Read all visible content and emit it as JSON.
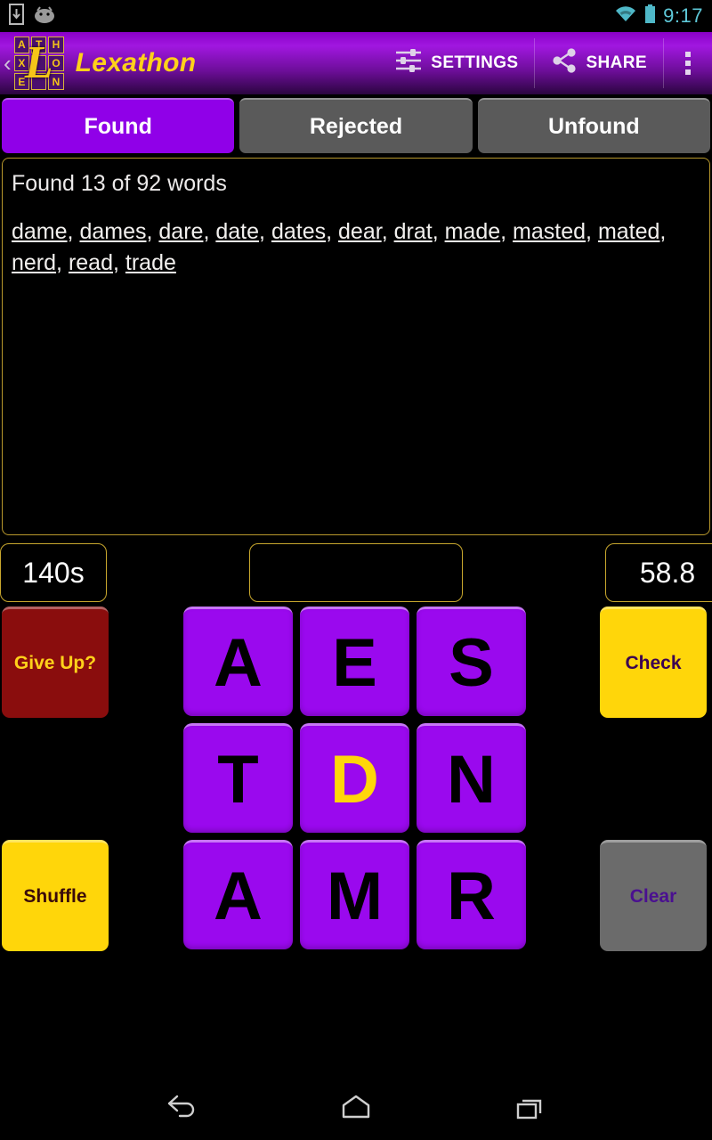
{
  "status_bar": {
    "icons": [
      "download-icon",
      "android-icon"
    ],
    "wifi_icon": "wifi-icon",
    "battery_icon": "battery-icon",
    "time": "9:17",
    "accent_color": "#5ec8d8"
  },
  "action_bar": {
    "up_caret": "‹",
    "logo": {
      "name": "lexathon-logo",
      "letters": [
        "A",
        "T",
        "H",
        "X",
        "",
        "O",
        "E",
        "",
        "N"
      ],
      "overlay_letter": "L",
      "tile_color": "#4a0f6e",
      "letter_color": "#f5c518"
    },
    "title": "Lexathon",
    "title_color": "#ffd11a",
    "settings_label": "SETTINGS",
    "share_label": "SHARE",
    "overflow_label": "more-options",
    "background_gradient": [
      "#8a00c8",
      "#2b0540"
    ]
  },
  "tabs": [
    {
      "label": "Found",
      "active": true
    },
    {
      "label": "Rejected",
      "active": false
    },
    {
      "label": "Unfound",
      "active": false
    }
  ],
  "tab_colors": {
    "active": "#9000e8",
    "inactive": "#5a5a5a"
  },
  "word_panel": {
    "summary": "Found 13 of 92 words",
    "found_count": 13,
    "total_count": 92,
    "words": [
      "dame",
      "dames",
      "dare",
      "date",
      "dates",
      "dear",
      "drat",
      "made",
      "masted",
      "mated",
      "nerd",
      "read",
      "trade"
    ],
    "separator": ", ",
    "border_color": "#b8982c"
  },
  "stats": {
    "timer": "140s",
    "entry_value": "",
    "entry_placeholder": "",
    "score": "58.8",
    "border_color": "#c9a82e"
  },
  "controls": {
    "give_up": "Give Up?",
    "shuffle": "Shuffle",
    "check": "Check",
    "clear": "Clear",
    "give_up_color": "#8a0d0d",
    "shuffle_color": "#ffd60a",
    "check_color": "#ffd60a",
    "clear_color": "#6b6b6b"
  },
  "letter_grid": {
    "tiles": [
      {
        "letter": "A",
        "key": false
      },
      {
        "letter": "E",
        "key": false
      },
      {
        "letter": "S",
        "key": false
      },
      {
        "letter": "T",
        "key": false
      },
      {
        "letter": "D",
        "key": true
      },
      {
        "letter": "N",
        "key": false
      },
      {
        "letter": "A",
        "key": false
      },
      {
        "letter": "M",
        "key": false
      },
      {
        "letter": "R",
        "key": false
      }
    ],
    "tile_color": "#9a09ee",
    "letter_color": "#000000",
    "key_letter_color": "#ffd60a"
  },
  "nav_bar": {
    "back": "back-icon",
    "home": "home-icon",
    "recents": "recents-icon"
  }
}
